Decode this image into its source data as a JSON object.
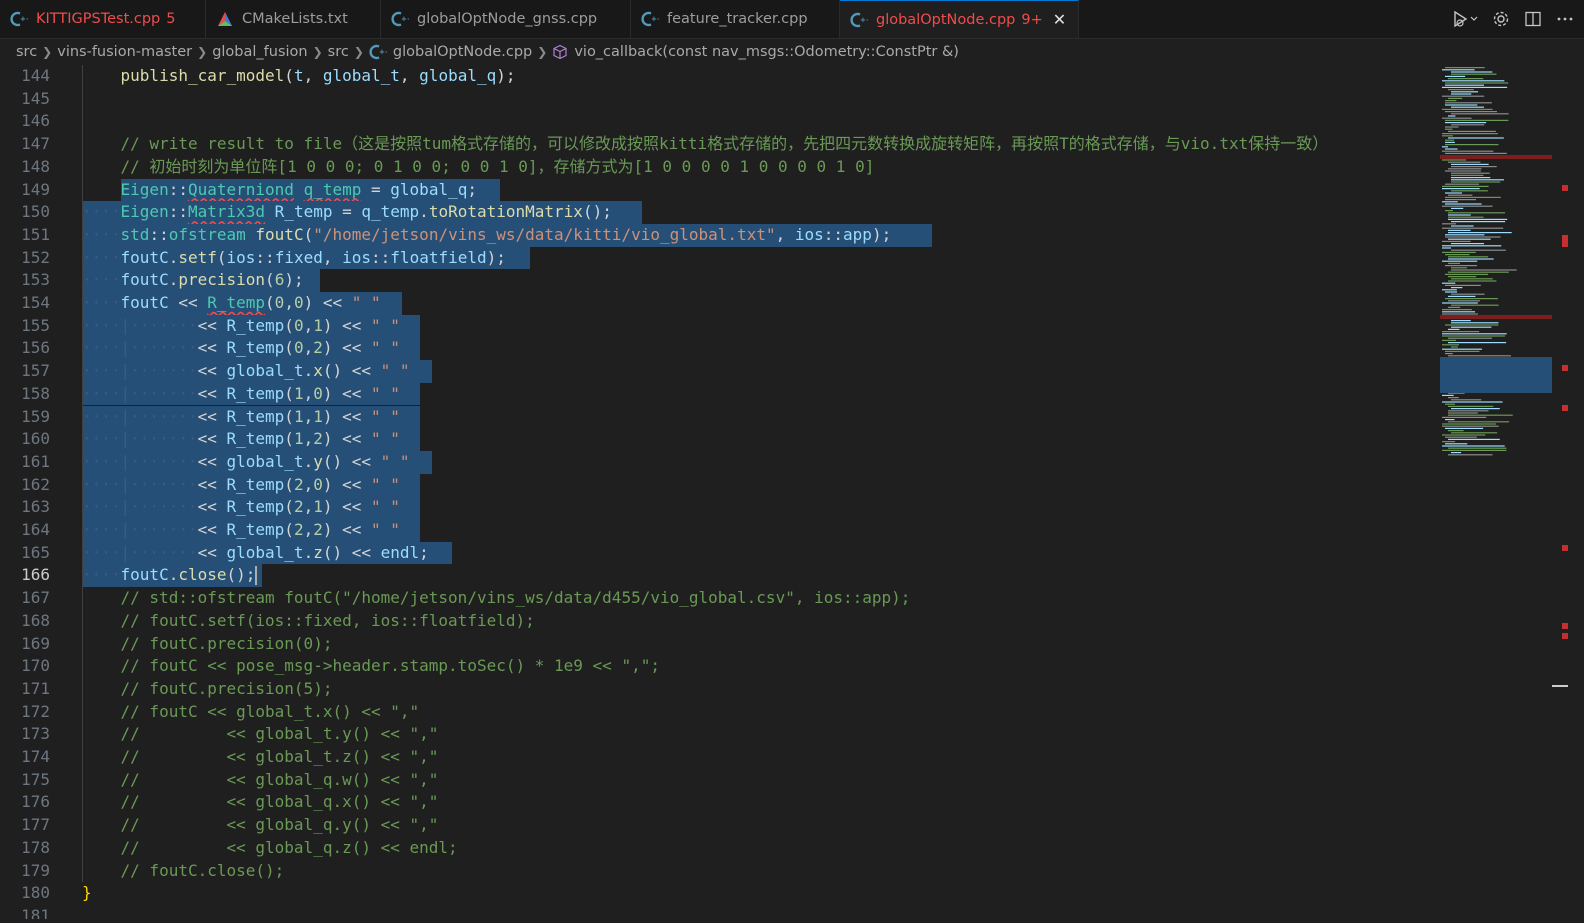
{
  "tabs": [
    {
      "name": "tab-kittigpstest",
      "label": "KITTIGPSTest.cpp",
      "badge": "5",
      "icon": "cpp-icon",
      "error": true,
      "active": false
    },
    {
      "name": "tab-cmakelists",
      "label": "CMakeLists.txt",
      "badge": "",
      "icon": "cmake-icon",
      "error": false,
      "active": false
    },
    {
      "name": "tab-globaloptnode-gnss",
      "label": "globalOptNode_gnss.cpp",
      "badge": "",
      "icon": "cpp-icon",
      "error": false,
      "active": false
    },
    {
      "name": "tab-feature-tracker",
      "label": "feature_tracker.cpp",
      "badge": "",
      "icon": "cpp-icon",
      "error": false,
      "active": false
    },
    {
      "name": "tab-globaloptnode",
      "label": "globalOptNode.cpp",
      "badge": "9+",
      "icon": "cpp-icon",
      "error": true,
      "active": true
    }
  ],
  "breadcrumb": [
    "src",
    "vins-fusion-master",
    "global_fusion",
    "src",
    "globalOptNode.cpp",
    "vio_callback(const nav_msgs::Odometry::ConstPtr &)"
  ],
  "current_line": 166,
  "code_lines": [
    {
      "n": 144,
      "tokens": [
        [
          "pl",
          "    "
        ],
        [
          "fn",
          "publish_car_model"
        ],
        [
          "pl",
          "("
        ],
        [
          "var",
          "t"
        ],
        [
          "pl",
          ", "
        ],
        [
          "var",
          "global_t"
        ],
        [
          "pl",
          ", "
        ],
        [
          "var",
          "global_q"
        ],
        [
          "pl",
          ");"
        ]
      ]
    },
    {
      "n": 145,
      "tokens": []
    },
    {
      "n": 146,
      "tokens": []
    },
    {
      "n": 147,
      "tokens": [
        [
          "pl",
          "    "
        ],
        [
          "cm",
          "// write result to file（这是按照tum格式存储的，可以修改成按照kitti格式存储的，先把四元数转换成旋转矩阵，再按照T的格式存储，与vio.txt保持一致）"
        ]
      ]
    },
    {
      "n": 148,
      "tokens": [
        [
          "pl",
          "    "
        ],
        [
          "cm",
          "// 初始时刻为单位阵[1 0 0 0; 0 1 0 0; 0 0 1 0]，存储方式为[1 0 0 0 0 1 0 0 0 0 1 0]"
        ]
      ]
    },
    {
      "n": 149,
      "tokens": [
        [
          "pl",
          "    "
        ],
        [
          "kw",
          "Eigen"
        ],
        [
          "pl",
          "::"
        ],
        [
          "sq",
          "Quaterniond"
        ],
        [
          "pl",
          " "
        ],
        [
          "sq",
          "q_temp"
        ],
        [
          "pl",
          " = "
        ],
        [
          "var",
          "global_q"
        ],
        [
          "pl",
          ";"
        ]
      ]
    },
    {
      "n": 150,
      "tokens": [
        [
          "ws",
          "····"
        ],
        [
          "kw",
          "Eigen"
        ],
        [
          "pl",
          "::"
        ],
        [
          "sq",
          "Matrix3d"
        ],
        [
          "pl",
          " "
        ],
        [
          "var",
          "R_temp"
        ],
        [
          "pl",
          " = "
        ],
        [
          "var",
          "q_temp"
        ],
        [
          "pl",
          "."
        ],
        [
          "fn",
          "toRotationMatrix"
        ],
        [
          "pl",
          "();"
        ]
      ]
    },
    {
      "n": 151,
      "tokens": [
        [
          "ws",
          "····"
        ],
        [
          "var",
          "std"
        ],
        [
          "pl",
          "::"
        ],
        [
          "kw",
          "ofstream"
        ],
        [
          "pl",
          " "
        ],
        [
          "fn",
          "foutC"
        ],
        [
          "pl",
          "("
        ],
        [
          "str",
          "\"/home/jetson/vins_ws/data/kitti/vio_global.txt\""
        ],
        [
          "pl",
          ", "
        ],
        [
          "var",
          "ios"
        ],
        [
          "pl",
          "::"
        ],
        [
          "var",
          "app"
        ],
        [
          "pl",
          ");"
        ]
      ]
    },
    {
      "n": 152,
      "tokens": [
        [
          "ws",
          "····"
        ],
        [
          "var",
          "foutC"
        ],
        [
          "pl",
          "."
        ],
        [
          "fn",
          "setf"
        ],
        [
          "pl",
          "("
        ],
        [
          "var",
          "ios"
        ],
        [
          "pl",
          "::"
        ],
        [
          "var",
          "fixed"
        ],
        [
          "pl",
          ", "
        ],
        [
          "var",
          "ios"
        ],
        [
          "pl",
          "::"
        ],
        [
          "var",
          "floatfield"
        ],
        [
          "pl",
          ");"
        ]
      ]
    },
    {
      "n": 153,
      "tokens": [
        [
          "ws",
          "····"
        ],
        [
          "var",
          "foutC"
        ],
        [
          "pl",
          "."
        ],
        [
          "fn",
          "precision"
        ],
        [
          "pl",
          "("
        ],
        [
          "num",
          "6"
        ],
        [
          "pl",
          ");"
        ]
      ]
    },
    {
      "n": 154,
      "tokens": [
        [
          "ws",
          "····"
        ],
        [
          "var",
          "foutC"
        ],
        [
          "pl",
          " << "
        ],
        [
          "sq",
          "R_temp"
        ],
        [
          "pl",
          "("
        ],
        [
          "num",
          "0"
        ],
        [
          "pl",
          ","
        ],
        [
          "num",
          "0"
        ],
        [
          "pl",
          ") << "
        ],
        [
          "str",
          "\" \""
        ]
      ]
    },
    {
      "n": 155,
      "tokens": [
        [
          "ws",
          "····|·······"
        ],
        [
          "pl",
          "<< "
        ],
        [
          "var",
          "R_temp"
        ],
        [
          "pl",
          "("
        ],
        [
          "num",
          "0"
        ],
        [
          "pl",
          ","
        ],
        [
          "num",
          "1"
        ],
        [
          "pl",
          ") << "
        ],
        [
          "str",
          "\" \""
        ]
      ]
    },
    {
      "n": 156,
      "tokens": [
        [
          "ws",
          "····|·······"
        ],
        [
          "pl",
          "<< "
        ],
        [
          "var",
          "R_temp"
        ],
        [
          "pl",
          "("
        ],
        [
          "num",
          "0"
        ],
        [
          "pl",
          ","
        ],
        [
          "num",
          "2"
        ],
        [
          "pl",
          ") << "
        ],
        [
          "str",
          "\" \""
        ]
      ]
    },
    {
      "n": 157,
      "tokens": [
        [
          "ws",
          "····|·······"
        ],
        [
          "pl",
          "<< "
        ],
        [
          "var",
          "global_t"
        ],
        [
          "pl",
          "."
        ],
        [
          "fn",
          "x"
        ],
        [
          "pl",
          "() << "
        ],
        [
          "str",
          "\" \""
        ]
      ]
    },
    {
      "n": 158,
      "tokens": [
        [
          "ws",
          "····|·······"
        ],
        [
          "pl",
          "<< "
        ],
        [
          "var",
          "R_temp"
        ],
        [
          "pl",
          "("
        ],
        [
          "num",
          "1"
        ],
        [
          "pl",
          ","
        ],
        [
          "num",
          "0"
        ],
        [
          "pl",
          ") << "
        ],
        [
          "str",
          "\" \""
        ]
      ]
    },
    {
      "n": 159,
      "tokens": [
        [
          "ws",
          "····|·······"
        ],
        [
          "pl",
          "<< "
        ],
        [
          "var",
          "R_temp"
        ],
        [
          "pl",
          "("
        ],
        [
          "num",
          "1"
        ],
        [
          "pl",
          ","
        ],
        [
          "num",
          "1"
        ],
        [
          "pl",
          ") << "
        ],
        [
          "str",
          "\" \""
        ]
      ]
    },
    {
      "n": 160,
      "tokens": [
        [
          "ws",
          "····|·······"
        ],
        [
          "pl",
          "<< "
        ],
        [
          "var",
          "R_temp"
        ],
        [
          "pl",
          "("
        ],
        [
          "num",
          "1"
        ],
        [
          "pl",
          ","
        ],
        [
          "num",
          "2"
        ],
        [
          "pl",
          ") << "
        ],
        [
          "str",
          "\" \""
        ]
      ]
    },
    {
      "n": 161,
      "tokens": [
        [
          "ws",
          "····|·······"
        ],
        [
          "pl",
          "<< "
        ],
        [
          "var",
          "global_t"
        ],
        [
          "pl",
          "."
        ],
        [
          "fn",
          "y"
        ],
        [
          "pl",
          "() << "
        ],
        [
          "str",
          "\" \""
        ]
      ]
    },
    {
      "n": 162,
      "tokens": [
        [
          "ws",
          "····|·······"
        ],
        [
          "pl",
          "<< "
        ],
        [
          "var",
          "R_temp"
        ],
        [
          "pl",
          "("
        ],
        [
          "num",
          "2"
        ],
        [
          "pl",
          ","
        ],
        [
          "num",
          "0"
        ],
        [
          "pl",
          ") << "
        ],
        [
          "str",
          "\" \""
        ]
      ]
    },
    {
      "n": 163,
      "tokens": [
        [
          "ws",
          "····|·······"
        ],
        [
          "pl",
          "<< "
        ],
        [
          "var",
          "R_temp"
        ],
        [
          "pl",
          "("
        ],
        [
          "num",
          "2"
        ],
        [
          "pl",
          ","
        ],
        [
          "num",
          "1"
        ],
        [
          "pl",
          ") << "
        ],
        [
          "str",
          "\" \""
        ]
      ]
    },
    {
      "n": 164,
      "tokens": [
        [
          "ws",
          "····|·······"
        ],
        [
          "pl",
          "<< "
        ],
        [
          "var",
          "R_temp"
        ],
        [
          "pl",
          "("
        ],
        [
          "num",
          "2"
        ],
        [
          "pl",
          ","
        ],
        [
          "num",
          "2"
        ],
        [
          "pl",
          ") << "
        ],
        [
          "str",
          "\" \""
        ]
      ]
    },
    {
      "n": 165,
      "tokens": [
        [
          "ws",
          "····|·······"
        ],
        [
          "pl",
          "<< "
        ],
        [
          "var",
          "global_t"
        ],
        [
          "pl",
          "."
        ],
        [
          "fn",
          "z"
        ],
        [
          "pl",
          "() << "
        ],
        [
          "var",
          "endl"
        ],
        [
          "pl",
          ";"
        ]
      ]
    },
    {
      "n": 166,
      "tokens": [
        [
          "ws",
          "····"
        ],
        [
          "var",
          "foutC"
        ],
        [
          "pl",
          "."
        ],
        [
          "fn",
          "close"
        ],
        [
          "pl",
          "();"
        ]
      ]
    },
    {
      "n": 167,
      "tokens": [
        [
          "pl",
          "    "
        ],
        [
          "cm",
          "// std::ofstream foutC(\"/home/jetson/vins_ws/data/d455/vio_global.csv\", ios::app);"
        ]
      ]
    },
    {
      "n": 168,
      "tokens": [
        [
          "pl",
          "    "
        ],
        [
          "cm",
          "// foutC.setf(ios::fixed, ios::floatfield);"
        ]
      ]
    },
    {
      "n": 169,
      "tokens": [
        [
          "pl",
          "    "
        ],
        [
          "cm",
          "// foutC.precision(0);"
        ]
      ]
    },
    {
      "n": 170,
      "tokens": [
        [
          "pl",
          "    "
        ],
        [
          "cm",
          "// foutC << pose_msg->header.stamp.toSec() * 1e9 << \",\";"
        ]
      ]
    },
    {
      "n": 171,
      "tokens": [
        [
          "pl",
          "    "
        ],
        [
          "cm",
          "// foutC.precision(5);"
        ]
      ]
    },
    {
      "n": 172,
      "tokens": [
        [
          "pl",
          "    "
        ],
        [
          "cm",
          "// foutC << global_t.x() << \",\""
        ]
      ]
    },
    {
      "n": 173,
      "tokens": [
        [
          "pl",
          "    "
        ],
        [
          "cm",
          "//         << global_t.y() << \",\""
        ]
      ]
    },
    {
      "n": 174,
      "tokens": [
        [
          "pl",
          "    "
        ],
        [
          "cm",
          "//         << global_t.z() << \",\""
        ]
      ]
    },
    {
      "n": 175,
      "tokens": [
        [
          "pl",
          "    "
        ],
        [
          "cm",
          "//         << global_q.w() << \",\""
        ]
      ]
    },
    {
      "n": 176,
      "tokens": [
        [
          "pl",
          "    "
        ],
        [
          "cm",
          "//         << global_q.x() << \",\""
        ]
      ]
    },
    {
      "n": 177,
      "tokens": [
        [
          "pl",
          "    "
        ],
        [
          "cm",
          "//         << global_q.y() << \",\""
        ]
      ]
    },
    {
      "n": 178,
      "tokens": [
        [
          "pl",
          "    "
        ],
        [
          "cm",
          "//         << global_q.z() << endl;"
        ]
      ]
    },
    {
      "n": 179,
      "tokens": [
        [
          "pl",
          "    "
        ],
        [
          "cm",
          "// foutC.close();"
        ]
      ]
    },
    {
      "n": 180,
      "tokens": [
        [
          "br",
          "}"
        ]
      ]
    },
    {
      "n": 181,
      "tokens": []
    }
  ],
  "colors": {
    "accent": "#0078d4",
    "error": "#f14c4c",
    "selection": "#264f78"
  }
}
